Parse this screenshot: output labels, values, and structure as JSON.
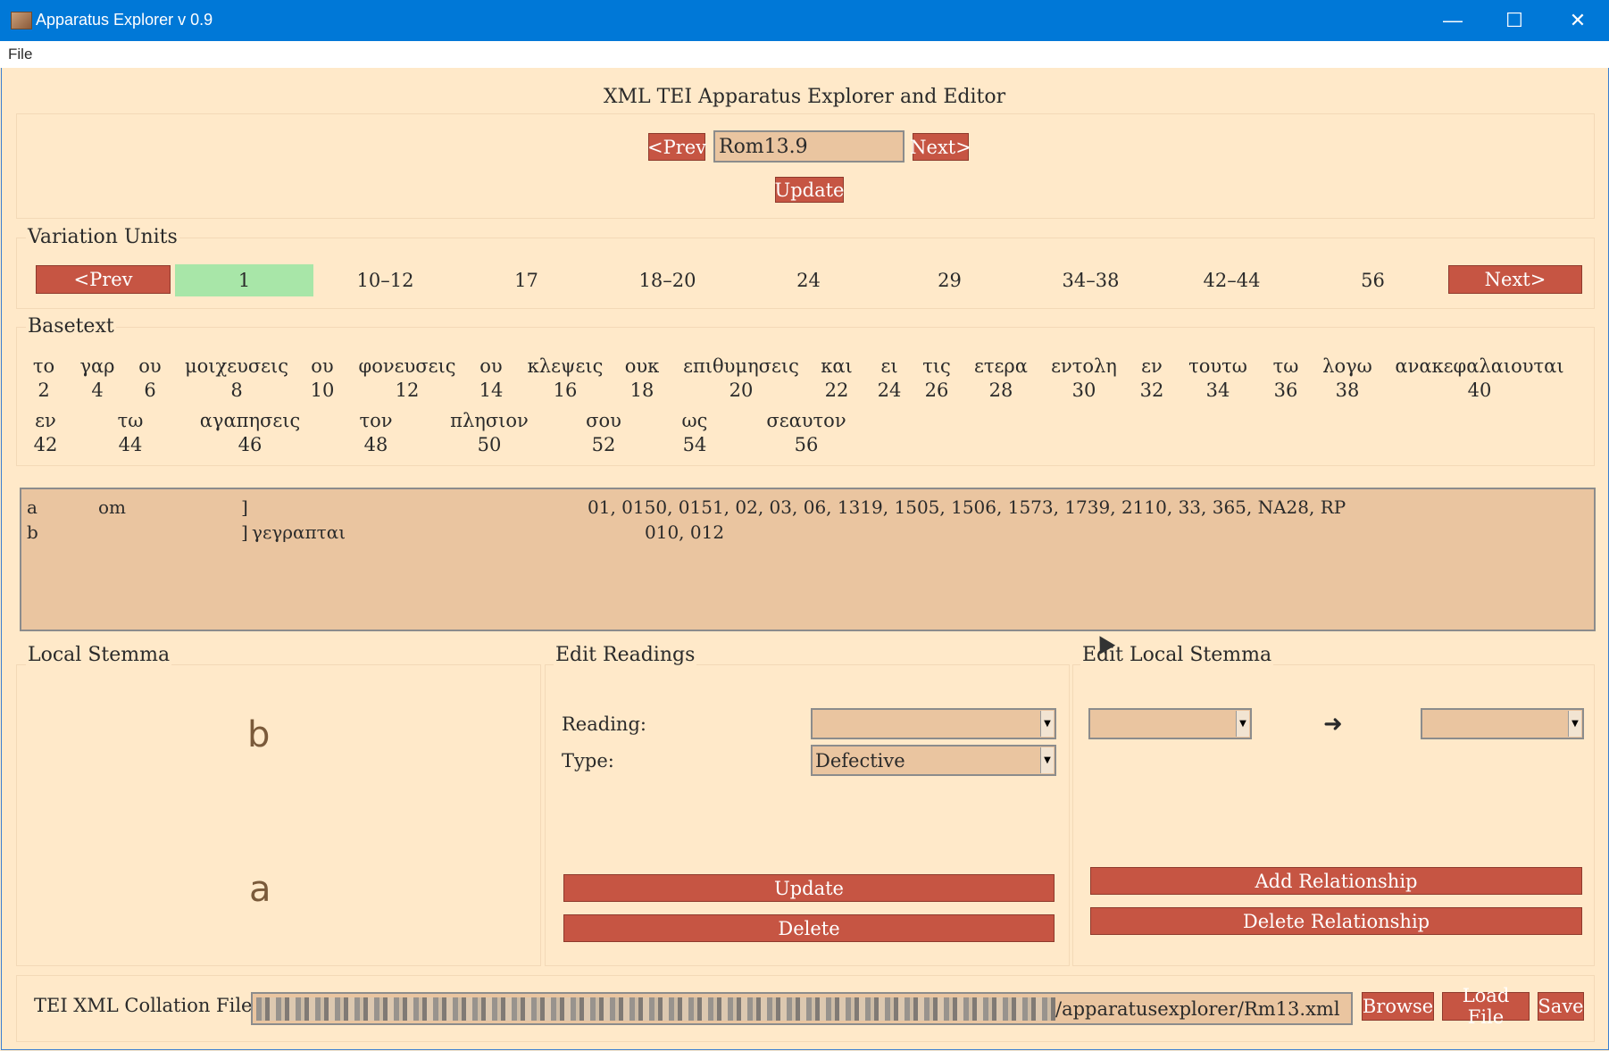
{
  "window": {
    "title": "Apparatus Explorer v 0.9",
    "min_glyph": "—",
    "max_glyph": "☐",
    "close_glyph": "✕"
  },
  "menu": {
    "file": "File"
  },
  "header": {
    "title": "XML TEI Apparatus Explorer and Editor",
    "prev": "<Prev",
    "verse": "Rom13.9",
    "next": "Next>",
    "update": "Update"
  },
  "variation_units": {
    "label": "Variation Units",
    "prev": "<Prev",
    "next": "Next>",
    "items": [
      "1",
      "10–12",
      "17",
      "18–20",
      "24",
      "29",
      "34–38",
      "42–44",
      "56"
    ],
    "selected_color": "#a8e6a8"
  },
  "basetext": {
    "label": "Basetext",
    "words": [
      {
        "w": "το",
        "n": "2"
      },
      {
        "w": "γαρ",
        "n": "4"
      },
      {
        "w": "ου",
        "n": "6"
      },
      {
        "w": "μοιχευσεις",
        "n": "8"
      },
      {
        "w": "ου",
        "n": "10"
      },
      {
        "w": "φονευσεις",
        "n": "12"
      },
      {
        "w": "ου",
        "n": "14"
      },
      {
        "w": "κλεψεις",
        "n": "16"
      },
      {
        "w": "ουκ",
        "n": "18"
      },
      {
        "w": "επιθυμησεις",
        "n": "20"
      },
      {
        "w": "και",
        "n": "22"
      },
      {
        "w": "ει",
        "n": "24"
      },
      {
        "w": "τις",
        "n": "26"
      },
      {
        "w": "ετερα",
        "n": "28"
      },
      {
        "w": "εντολη",
        "n": "30"
      },
      {
        "w": "εν",
        "n": "32"
      },
      {
        "w": "τουτω",
        "n": "34"
      },
      {
        "w": "τω",
        "n": "36"
      },
      {
        "w": "λογω",
        "n": "38"
      },
      {
        "w": "ανακεφαλαιουται",
        "n": "40"
      },
      {
        "w": "εν",
        "n": "42"
      },
      {
        "w": "τω",
        "n": "44"
      },
      {
        "w": "αγαπησεις",
        "n": "46"
      },
      {
        "w": "τον",
        "n": "48"
      },
      {
        "w": "πλησιον",
        "n": "50"
      },
      {
        "w": "σου",
        "n": "52"
      },
      {
        "w": "ως",
        "n": "54"
      },
      {
        "w": "σεαυτον",
        "n": "56"
      }
    ]
  },
  "readings": [
    {
      "id": "a",
      "text": "om",
      "bracket": "]",
      "reading": "",
      "witnesses": "01, 0150, 0151, 02, 03, 06, 1319, 1505, 1506, 1573, 1739, 2110, 33, 365, NA28, RP"
    },
    {
      "id": "b",
      "text": "",
      "bracket": "]",
      "reading": "γεγραπται",
      "witnesses": "010, 012"
    }
  ],
  "local_stemma": {
    "label": "Local Stemma",
    "nodes": [
      "b",
      "a"
    ]
  },
  "edit_readings": {
    "label": "Edit Readings",
    "reading_label": "Reading:",
    "reading_value": "",
    "type_label": "Type:",
    "type_value": "Defective",
    "update": "Update",
    "delete": "Delete"
  },
  "edit_stemma": {
    "label": "Edit Local Stemma",
    "from_value": "",
    "to_value": "",
    "arrow": "➜",
    "add": "Add Relationship",
    "delete": "Delete Relationship"
  },
  "footer": {
    "label": "TEI XML Collation File:",
    "path_visible": "/apparatusexplorer/Rm13.xml",
    "browse": "Browse",
    "load": "Load File",
    "save": "Save"
  },
  "colors": {
    "background": "#ffe9c9",
    "button": "#c65543",
    "entry": "#eac5a0",
    "titlebar": "#0078d7"
  },
  "icons": {
    "app": "app-icon",
    "combo": "dropdown-arrow-icon",
    "cursor": "mouse-pointer-icon"
  }
}
